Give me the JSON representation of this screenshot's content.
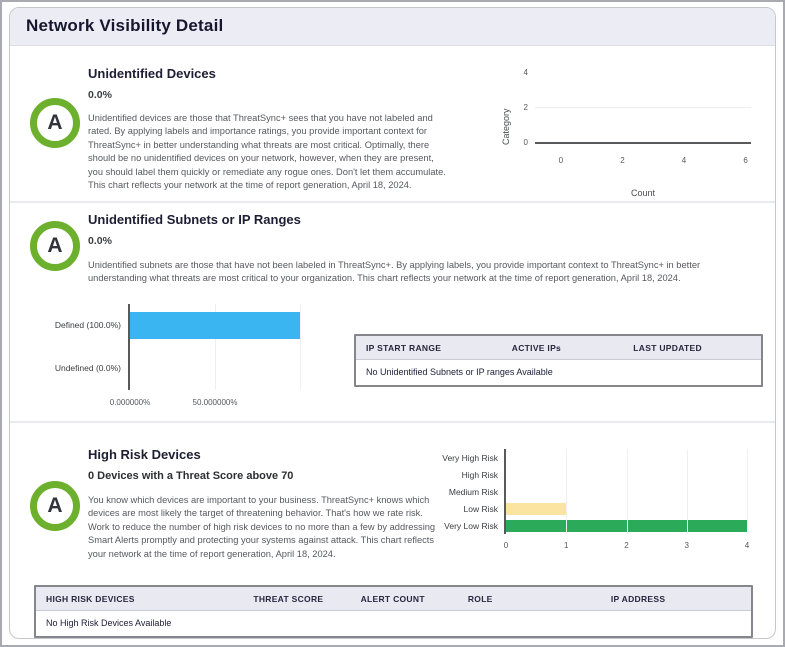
{
  "window": {
    "title": "Network Visibility Detail"
  },
  "sections": [
    {
      "grade": "A",
      "title": "Unidentified Devices",
      "metric": "0.0%",
      "description": "Unidentified devices are those that ThreatSync+ sees that you have not labeled and rated. By applying labels and importance ratings, you provide important context for ThreatSync+ in better understanding what threats are most critical. Optimally, there should be no unidentified devices on your network, however, when they are present, you should label them quickly or remediate any rogue ones. Don't let them accumulate. This chart reflects your network at the time of report generation, April 18, 2024."
    },
    {
      "grade": "A",
      "title": "Unidentified Subnets or IP Ranges",
      "metric": "0.0%",
      "description": "Unidentified subnets are those that have not been labeled in ThreatSync+. By applying labels, you provide important context to ThreatSync+ in better understanding what threats are most critical to your organization. This chart reflects your network at the time of report generation, April 18, 2024.",
      "table": {
        "headers": [
          "IP START RANGE",
          "ACTIVE IPs",
          "LAST UPDATED"
        ],
        "empty_message": "No Unidentified Subnets or IP ranges Available"
      }
    },
    {
      "grade": "A",
      "title": "High Risk Devices",
      "subtitle": "0 Devices with a Threat Score above 70",
      "description": "You know which devices are important to your business. ThreatSync+ knows which devices are most likely the target of threatening behavior. That's how we rate risk. Work to reduce the number of high risk devices to no more than a few by addressing Smart Alerts promptly and protecting your systems against attack. This chart reflects your network at the time of report generation, April 18, 2024.",
      "table": {
        "headers": [
          "HIGH RISK DEVICES",
          "THREAT SCORE",
          "ALERT COUNT",
          "ROLE",
          "IP ADDRESS"
        ],
        "empty_message": "No High Risk Devices Available"
      }
    }
  ],
  "chart_data": [
    {
      "type": "bar",
      "orientation": "horizontal",
      "xlabel": "Count",
      "ylabel": "Category",
      "xticks": [
        "0",
        "2",
        "4",
        "6"
      ],
      "yticks": [
        "4",
        "2",
        "0"
      ],
      "xlim": [
        0,
        6
      ],
      "ylim": [
        0,
        4
      ],
      "categories": [],
      "values": []
    },
    {
      "type": "bar",
      "orientation": "horizontal",
      "categories": [
        "Defined (100.0%)",
        "Undefined (0.0%)"
      ],
      "values": [
        100,
        0
      ],
      "xticks": [
        "0.000000%",
        "50.000000%"
      ],
      "xlim": [
        0,
        100
      ],
      "bar_colors": [
        "#3AB5F2",
        "#3AB5F2"
      ],
      "grid": true,
      "legend": "none"
    },
    {
      "type": "bar",
      "orientation": "horizontal",
      "categories": [
        "Very High Risk",
        "High Risk",
        "Medium Risk",
        "Low Risk",
        "Very Low Risk"
      ],
      "values": [
        0,
        0,
        0,
        1,
        4
      ],
      "xticks": [
        "0",
        "1",
        "2",
        "3",
        "4"
      ],
      "xlim": [
        0,
        4
      ],
      "bar_colors": [
        "#2BAB5A",
        "#2BAB5A",
        "#2BAB5A",
        "#FBE3A2",
        "#2BAB5A"
      ],
      "grid": true,
      "legend": "none"
    }
  ],
  "colors": {
    "grade_ring_green": "#6CB02E",
    "header_bg": "#ECEDF4",
    "table_header_bg": "#E9EAF1",
    "bar_blue": "#3AB5F2",
    "bar_yellow": "#FBE3A2",
    "bar_green": "#2BAB5A"
  }
}
